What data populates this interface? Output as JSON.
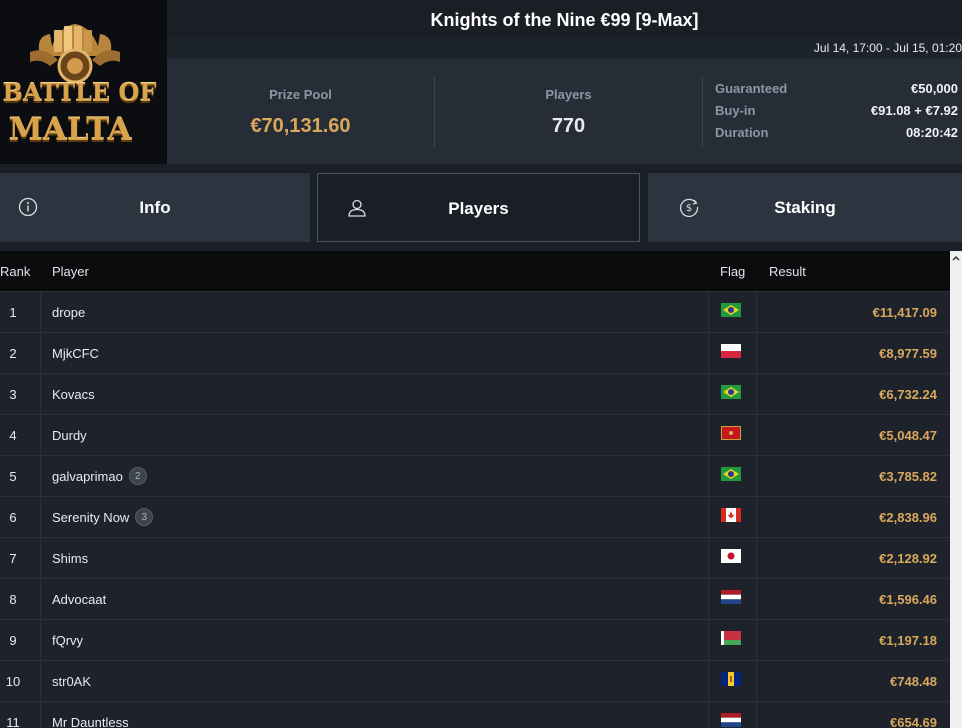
{
  "logo": {
    "line1": "BATTLE OF",
    "line2": "MALTA"
  },
  "header": {
    "title": "Knights of the Nine €99 [9-Max]",
    "dates": "Jul 14, 17:00 - Jul 15, 01:20"
  },
  "stats": {
    "prize_pool_label": "Prize Pool",
    "prize_pool_value": "€70,131.60",
    "players_label": "Players",
    "players_value": "770",
    "guaranteed_label": "Guaranteed",
    "guaranteed_value": "€50,000",
    "buyin_label": "Buy-in",
    "buyin_value": "€91.08 + €7.92",
    "duration_label": "Duration",
    "duration_value": "08:20:42"
  },
  "tabs": [
    {
      "label": "Info",
      "icon": "info-icon"
    },
    {
      "label": "Players",
      "icon": "user-icon"
    },
    {
      "label": "Staking",
      "icon": "dollar-coin-icon"
    }
  ],
  "table": {
    "headers": {
      "rank": "Rank",
      "player": "Player",
      "flag": "Flag",
      "result": "Result"
    },
    "rows": [
      {
        "rank": "1",
        "player": "drope",
        "badge": "",
        "flag": "brazil",
        "result": "€11,417.09"
      },
      {
        "rank": "2",
        "player": "MjkCFC",
        "badge": "",
        "flag": "poland",
        "result": "€8,977.59"
      },
      {
        "rank": "3",
        "player": "Kovacs",
        "badge": "",
        "flag": "brazil",
        "result": "€6,732.24"
      },
      {
        "rank": "4",
        "player": "Durdy",
        "badge": "",
        "flag": "montenegro",
        "result": "€5,048.47"
      },
      {
        "rank": "5",
        "player": "galvaprimao",
        "badge": "2",
        "flag": "brazil",
        "result": "€3,785.82"
      },
      {
        "rank": "6",
        "player": "Serenity Now",
        "badge": "3",
        "flag": "canada",
        "result": "€2,838.96"
      },
      {
        "rank": "7",
        "player": "Shims",
        "badge": "",
        "flag": "japan",
        "result": "€2,128.92"
      },
      {
        "rank": "8",
        "player": "Advocaat",
        "badge": "",
        "flag": "netherlands",
        "result": "€1,596.46"
      },
      {
        "rank": "9",
        "player": "fQrvy",
        "badge": "",
        "flag": "belarus",
        "result": "€1,197.18"
      },
      {
        "rank": "10",
        "player": "str0AK",
        "badge": "",
        "flag": "barbados",
        "result": "€748.48"
      },
      {
        "rank": "11",
        "player": "Mr Dauntless",
        "badge": "",
        "flag": "netherlands",
        "result": "€654.69"
      }
    ]
  },
  "colors": {
    "accent_gold": "#d9a85c",
    "background": "#1b2028",
    "panel": "#262d37"
  }
}
